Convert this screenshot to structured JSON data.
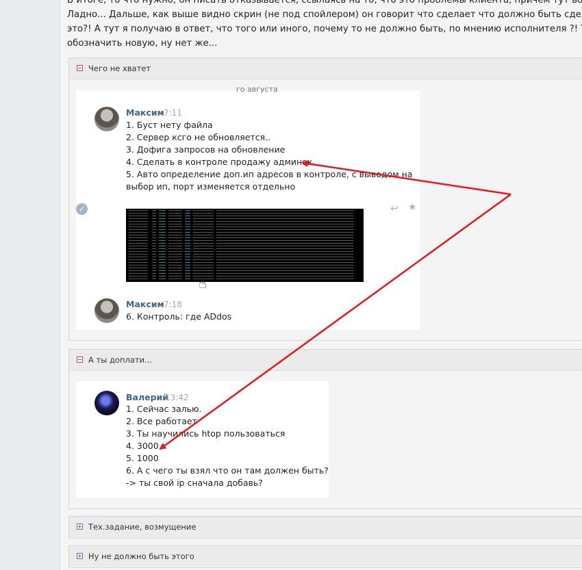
{
  "intro": {
    "line1": "В итоге, то что нужно, он писать отказывается, ссылаясь на то, что это проблемы клиента, причем тут вобще клиент?",
    "line2": "Ладно... Дальше, как выше видно скрин (не под спойлером) он говорит что сделает что должно быть сделано !!! НО",
    "line3": "это?! А тут я получаю в ответ, что того или иного, почему то не должно быть, по мнению исполнителя ?! Так кто же",
    "line4": "обозначить новую, ну нет же..."
  },
  "spoilers": [
    {
      "title": "Чего не хватет"
    },
    {
      "title": "А ты доплати..."
    },
    {
      "title": "Тех.задание, возмущение"
    },
    {
      "title": "Ну не должно быть этого"
    }
  ],
  "chat1": {
    "top_clip": "го августа",
    "msg1": {
      "name": "Максим",
      "time": "7:11",
      "lines": [
        "1. Буст нету файла",
        "2. Сервер ксго не обновляется..",
        "3. Дофига запросов на обновление",
        "4. Сделать в контроле продажу админок",
        "5. Авто определение доп.ип адресов в контроле, с выводом на",
        "выбор ип, порт изменяется отдельно"
      ]
    },
    "msg2": {
      "name": "Максим",
      "time": "7:18",
      "lines": [
        "6. Контроль: где ADdos"
      ]
    }
  },
  "chat2": {
    "msg1": {
      "name": "Валерий",
      "time": "13:42",
      "lines": [
        "1. Сейчас залью.",
        "2. Все работает",
        "3. Ты научились htop пользоваться",
        "4. 3000",
        "5. 1000",
        "6. А с чего ты взял что он там должен быть?",
        "-> ты свой ip сначала добавь?"
      ]
    }
  },
  "colors": {
    "arrow": "#e8171b",
    "name": "#42648b"
  },
  "icons": [
    "check-icon",
    "reply-icon",
    "star-icon",
    "cursor-icon"
  ]
}
